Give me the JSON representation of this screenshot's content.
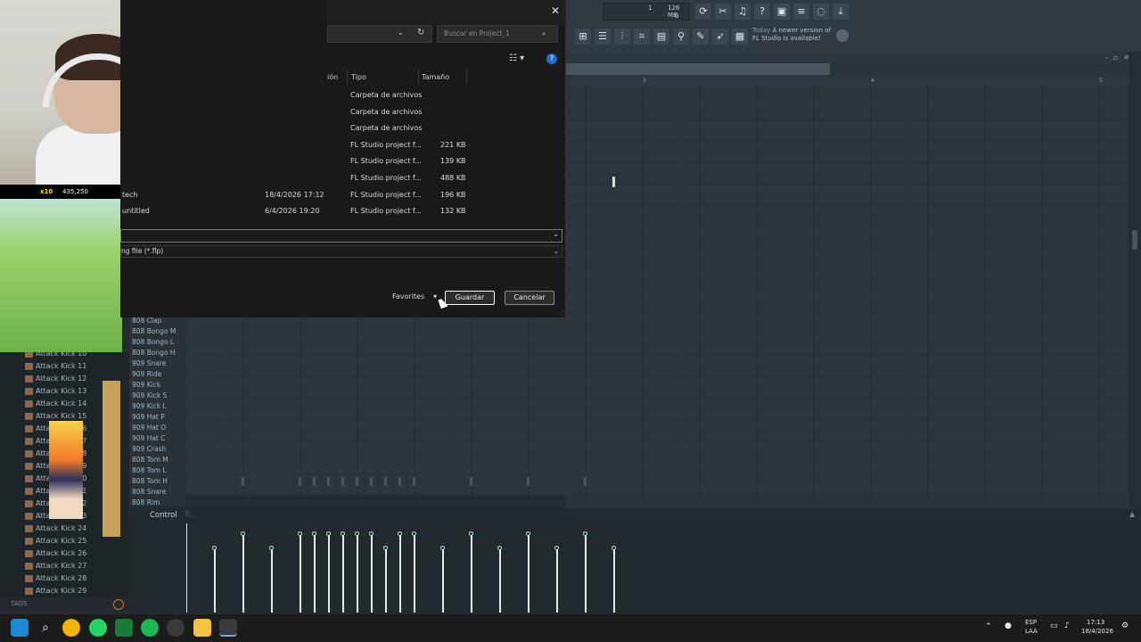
{
  "fl": {
    "cpu_line1": "1",
    "cpu_mem": "126 MB",
    "cpu_line2": "0",
    "news_line1": "Today",
    "news_line2": "A newer version of",
    "news_line3": "FL Studio is available!",
    "ruler": [
      "3",
      "4",
      "5"
    ],
    "control_label": "Control",
    "control_sub": "Tr...",
    "tags_label": "TAGS"
  },
  "channels": [
    "808 Clap",
    "808 Bongo M",
    "808 Bongo L",
    "808 Bongo H",
    "909 Snare",
    "909 Ride",
    "909 Kick",
    "909 Kick S",
    "909 Kick L",
    "909 Hat P",
    "909 Hat O",
    "909 Hat C",
    "909 Crash",
    "808 Tom M",
    "808 Tom L",
    "808 Tom H",
    "808 Snare",
    "808 Rim"
  ],
  "browser": {
    "items": [
      "Attack Kick 10",
      "Attack Kick 11",
      "Attack Kick 12",
      "Attack Kick 13",
      "Attack Kick 14",
      "Attack Kick 15",
      "Attack Kick 16",
      "Attack Kick 17",
      "Attack Kick 18",
      "Attack Kick 19",
      "Attack Kick 20",
      "Attack Kick 21",
      "Attack Kick 22",
      "Attack Kick 23",
      "Attack Kick 24",
      "Attack Kick 25",
      "Attack Kick 26",
      "Attack Kick 27",
      "Attack Kick 28",
      "Attack Kick 29"
    ]
  },
  "game": {
    "multiplier": "x10",
    "score": "435,250"
  },
  "dialog": {
    "close": "✕",
    "search_placeholder": "Buscar en Project_1",
    "columns": {
      "date": "ión",
      "type": "Tipo",
      "size": "Tamaño"
    },
    "rows": [
      {
        "name": "",
        "date": "",
        "type": "Carpeta de archivos",
        "size": ""
      },
      {
        "name": "",
        "date": "",
        "type": "Carpeta de archivos",
        "size": ""
      },
      {
        "name": "",
        "date": "",
        "type": "Carpeta de archivos",
        "size": ""
      },
      {
        "name": "",
        "date": "",
        "type": "FL Studio project f...",
        "size": "221 KB"
      },
      {
        "name": "",
        "date": "",
        "type": "FL Studio project f...",
        "size": "139 KB"
      },
      {
        "name": "",
        "date": "",
        "type": "FL Studio project f...",
        "size": "488 KB"
      },
      {
        "name": "tech",
        "date": "18/4/2026 17:12",
        "type": "FL Studio project f...",
        "size": "196 KB"
      },
      {
        "name": "untitled",
        "date": "6/4/2026 19:20",
        "type": "FL Studio project f...",
        "size": "132 KB"
      }
    ],
    "file_type": "ng file (*.flp)",
    "favorites": "Favorites",
    "save": "Guardar",
    "cancel": "Cancelar"
  },
  "taskbar": {
    "lang1": "ESP",
    "lang2": "LAA",
    "time": "17:13",
    "date": "18/4/2026"
  },
  "colors": {
    "fl_bg": "#2b3439",
    "dialog_bg": "#191919",
    "accent_blue": "#1e6fd1",
    "velocity_green": "#b9ebc6"
  }
}
